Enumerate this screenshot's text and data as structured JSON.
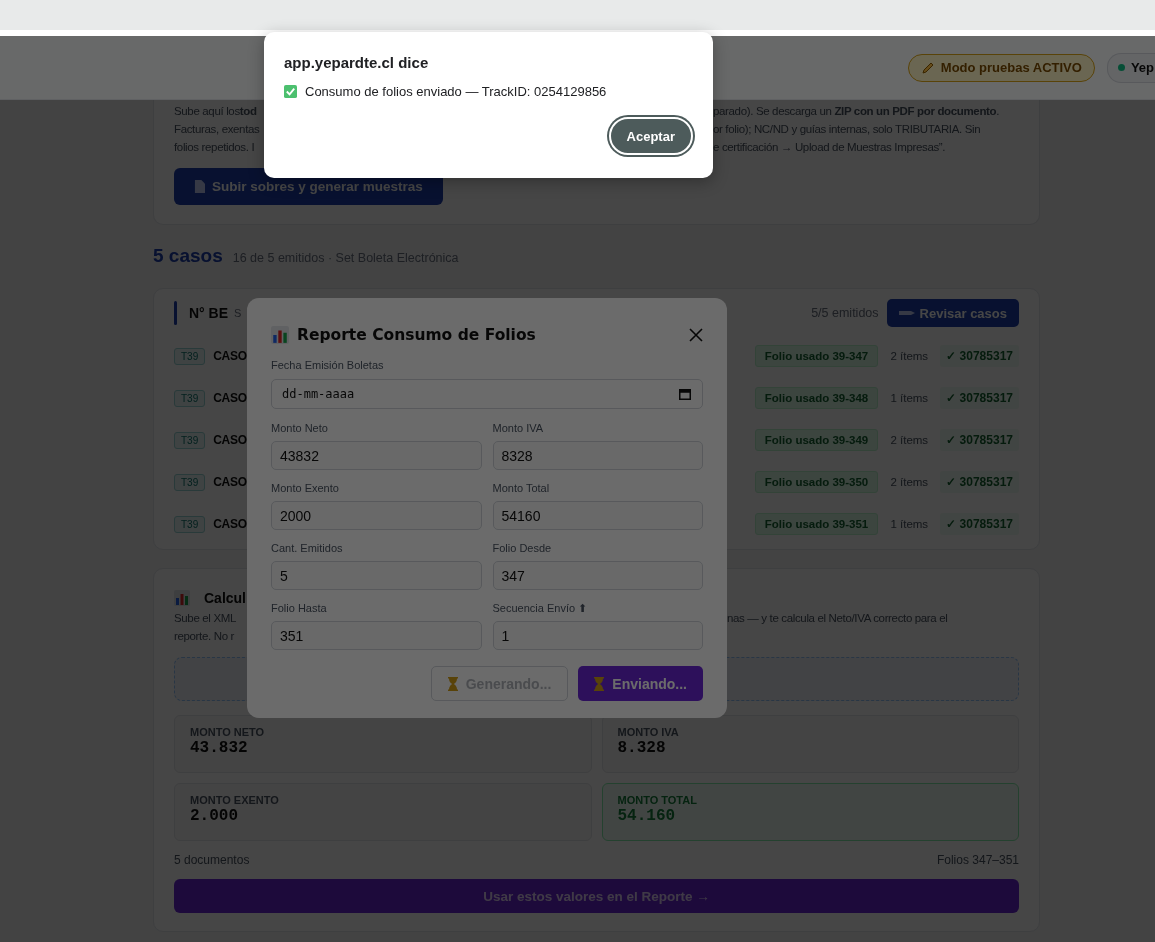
{
  "header": {
    "test_mode_badge": "Modo pruebas ACTIVO",
    "status_pill": "Yep"
  },
  "upload_card": {
    "lines": [
      {
        "left": "Sube aquí los**tod**",
        "right": "parado). Se descarga un **ZIP con un PDF por documento**."
      },
      {
        "left": "Facturas, exentas",
        "right": "or folio); NC/ND y guías internas, solo TRIBUTARIA. Sin"
      },
      {
        "left": "folios repetidos. I",
        "right": "e certificación → Upload de Muestras Impresas”."
      }
    ],
    "button": "Subir sobres y generar muestras"
  },
  "cases_heading": {
    "count": "5 casos",
    "summary": "16 de 5 emitidos · Set Boleta Electrónica"
  },
  "cases_card": {
    "title": "N° BE",
    "subtitle": "S",
    "emitted": "5/5 emitidos",
    "review_button": "Revisar casos",
    "rows": [
      {
        "type": "T39",
        "name": "CASO",
        "folio": "Folio usado 39-347",
        "items": "2 ítems",
        "track": "✓ 30785317"
      },
      {
        "type": "T39",
        "name": "CASO",
        "folio": "Folio usado 39-348",
        "items": "1 ítems",
        "track": "✓ 30785317"
      },
      {
        "type": "T39",
        "name": "CASO",
        "folio": "Folio usado 39-349",
        "items": "2 ítems",
        "track": "✓ 30785317"
      },
      {
        "type": "T39",
        "name": "CASO",
        "folio": "Folio usado 39-350",
        "items": "2 ítems",
        "track": "✓ 30785317"
      },
      {
        "type": "T39",
        "name": "CASO",
        "folio": "Folio usado 39-351",
        "items": "1 ítems",
        "track": "✓ 30785317"
      }
    ]
  },
  "calc_card": {
    "title": "Calcul",
    "lines": [
      {
        "left": "Sube el XML",
        "right": "nas — y te calcula el Neto/IVA correcto para el"
      },
      {
        "left": "reporte. No r"
      }
    ],
    "stats": [
      {
        "label": "MONTO NETO",
        "value": "43.832",
        "kind": "plain"
      },
      {
        "label": "MONTO IVA",
        "value": "8.328",
        "kind": "plain"
      },
      {
        "label": "MONTO EXENTO",
        "value": "2.000",
        "kind": "plain"
      },
      {
        "label": "MONTO TOTAL",
        "value": "54.160",
        "kind": "total"
      }
    ],
    "documents": "5 documentos",
    "folios": "Folios 347–351",
    "apply_button": "Usar estos valores en el Reporte →"
  },
  "modal": {
    "title": "Reporte Consumo de Folios",
    "date_field": {
      "label": "Fecha Emisión Boletas",
      "placeholder": "dd-mm-aaaa"
    },
    "fields": [
      {
        "label": "Monto Neto",
        "value": "43832"
      },
      {
        "label": "Monto IVA",
        "value": "8328"
      },
      {
        "label": "Monto Exento",
        "value": "2000"
      },
      {
        "label": "Monto Total",
        "value": "54160"
      },
      {
        "label": "Cant. Emitidos",
        "value": "5"
      },
      {
        "label": "Folio Desde",
        "value": "347"
      },
      {
        "label": "Folio Hasta",
        "value": "351"
      },
      {
        "label": "Secuencia Envío ⬆",
        "value": "1"
      }
    ],
    "buttons": [
      {
        "label": "Generando...",
        "kind": "secondary",
        "disabled": true
      },
      {
        "label": "Enviando...",
        "kind": "primary",
        "disabled": false
      }
    ]
  },
  "alert": {
    "title": "app.yepardte.cl dice",
    "message": "Consumo de folios enviado — TrackID: 0254129856",
    "button": "Aceptar"
  }
}
